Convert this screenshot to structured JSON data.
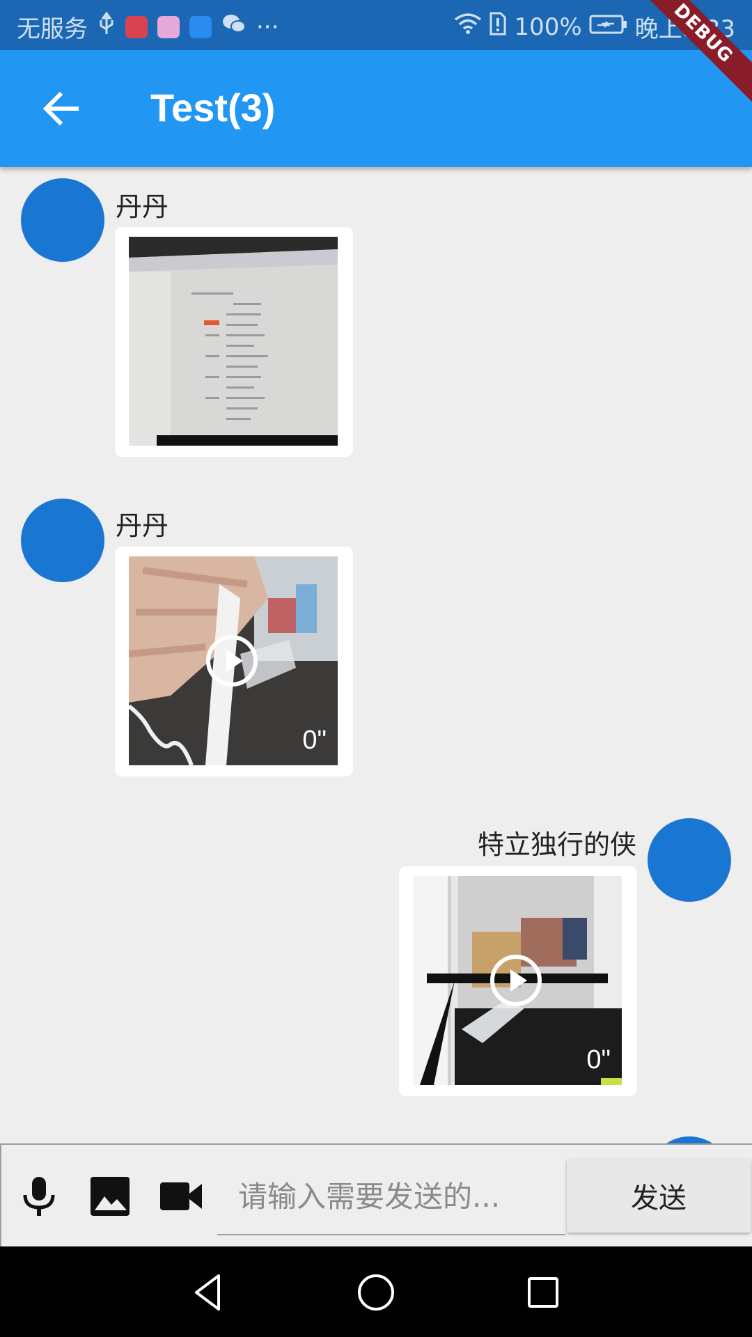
{
  "status_bar": {
    "carrier": "无服务",
    "battery": "100%",
    "time": "晚上8:33",
    "more": "···"
  },
  "debug_banner": "DEBUG",
  "app_bar": {
    "title": "Test(3)"
  },
  "messages": [
    {
      "sender": "丹丹",
      "type": "image",
      "side": "left"
    },
    {
      "sender": "丹丹",
      "type": "video",
      "duration": "0\"",
      "side": "left"
    },
    {
      "sender": "特立独行的侠",
      "type": "video",
      "duration": "0\"",
      "side": "right"
    }
  ],
  "input_bar": {
    "placeholder": "请输入需要发送的...",
    "send_label": "发送"
  },
  "colors": {
    "app_bar": "#2196f3",
    "status_bar": "#1b67b3",
    "avatar": "#1976d2",
    "background": "#eeeeee"
  }
}
